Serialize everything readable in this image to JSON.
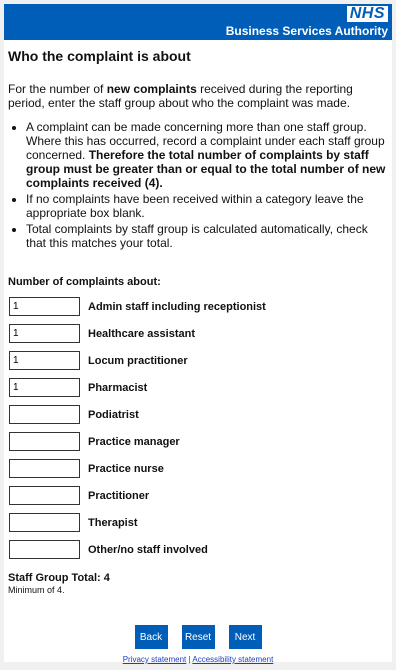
{
  "header": {
    "logo": "NHS",
    "organisation": "Business Services Authority"
  },
  "page": {
    "title": "Who the complaint is about",
    "intro_before": "For the number of ",
    "intro_bold": "new complaints",
    "intro_after": " received during the reporting period, enter the staff group about who the  complaint was made."
  },
  "bullets": {
    "b1_plain": "A complaint can be made concerning more than one staff group. Where this has occurred, record a complaint under each staff group concerned. ",
    "b1_bold": "Therefore the total number of complaints by staff group must be greater than or equal to the total number of new complaints received (4).",
    "b2": "If no complaints have been received within a category leave the appropriate box blank.",
    "b3": "Total complaints by staff group is calculated automatically, check that this matches your total."
  },
  "form": {
    "heading": "Number of complaints about:",
    "rows": [
      {
        "label": "Admin staff including receptionist",
        "value": "1"
      },
      {
        "label": "Healthcare assistant",
        "value": "1"
      },
      {
        "label": "Locum practitioner",
        "value": "1"
      },
      {
        "label": "Pharmacist",
        "value": "1"
      },
      {
        "label": "Podiatrist",
        "value": ""
      },
      {
        "label": "Practice manager",
        "value": ""
      },
      {
        "label": "Practice nurse",
        "value": ""
      },
      {
        "label": "Practitioner",
        "value": ""
      },
      {
        "label": "Therapist",
        "value": ""
      },
      {
        "label": "Other/no staff involved",
        "value": ""
      }
    ],
    "total_text": "Staff Group Total: 4",
    "minimum_text": "Minimum of 4."
  },
  "buttons": {
    "back": "Back",
    "reset": "Reset",
    "next": "Next"
  },
  "footer": {
    "privacy": "Privacy statement",
    "separator": "|",
    "accessibility": "Accessibility statement"
  },
  "colors": {
    "brand_blue": "#005eb8",
    "link": "#1a3fbf"
  }
}
